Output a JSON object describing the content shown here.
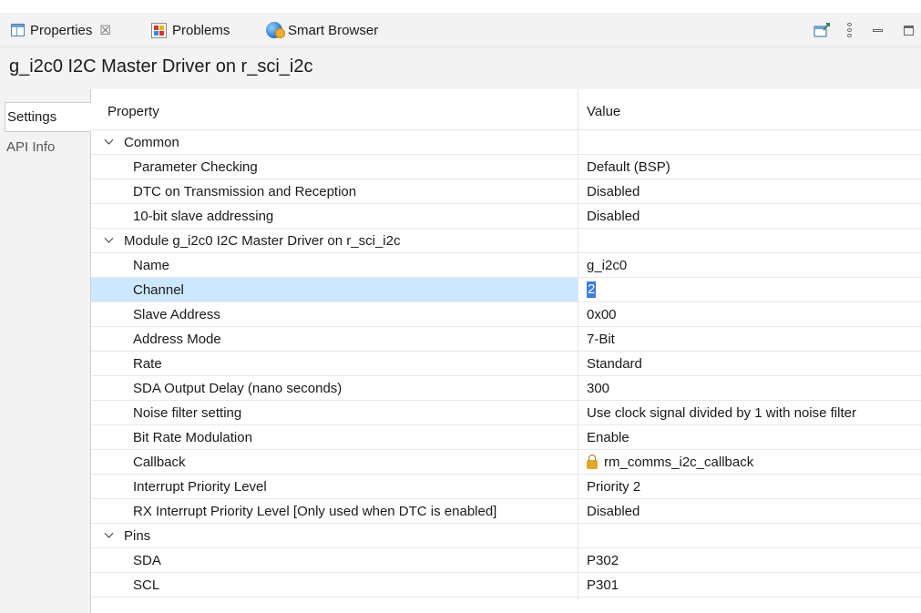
{
  "tabs": {
    "properties": "Properties",
    "properties_close": "☒",
    "problems": "Problems",
    "smart_browser": "Smart Browser"
  },
  "title": "g_i2c0 I2C Master Driver on r_sci_i2c",
  "side_tabs": [
    "Settings",
    "API Info"
  ],
  "table": {
    "header_property": "Property",
    "header_value": "Value"
  },
  "groups": {
    "common": {
      "label": "Common",
      "rows": [
        {
          "property": "Parameter Checking",
          "value": "Default (BSP)"
        },
        {
          "property": "DTC on Transmission and Reception",
          "value": "Disabled"
        },
        {
          "property": "10-bit slave addressing",
          "value": "Disabled"
        }
      ]
    },
    "module": {
      "label": "Module g_i2c0 I2C Master Driver on r_sci_i2c",
      "rows": [
        {
          "property": "Name",
          "value": "g_i2c0"
        },
        {
          "property": "Channel",
          "value": "2"
        },
        {
          "property": "Slave Address",
          "value": "0x00"
        },
        {
          "property": "Address Mode",
          "value": "7-Bit"
        },
        {
          "property": "Rate",
          "value": "Standard"
        },
        {
          "property": "SDA Output Delay (nano seconds)",
          "value": "300"
        },
        {
          "property": "Noise filter setting",
          "value": "Use clock signal divided by 1 with noise filter"
        },
        {
          "property": "Bit Rate Modulation",
          "value": "Enable"
        },
        {
          "property": "Callback",
          "value": "rm_comms_i2c_callback"
        },
        {
          "property": "Interrupt Priority Level",
          "value": "Priority 2"
        },
        {
          "property": "RX Interrupt Priority Level [Only used when DTC is enabled]",
          "value": "Disabled"
        }
      ]
    },
    "pins": {
      "label": "Pins",
      "rows": [
        {
          "property": "SDA",
          "value": "P302"
        },
        {
          "property": "SCL",
          "value": "P301"
        }
      ]
    }
  },
  "colors": {
    "selection": "#cce8ff",
    "edit_highlight": "#3b7be0",
    "tabbar_bg": "#f3f3f3"
  },
  "icons": [
    "properties-view-icon",
    "problems-view-icon",
    "smart-browser-icon",
    "pin-editor-icon",
    "view-menu-icon",
    "minimize-icon",
    "maximize-icon",
    "lock-icon",
    "chevron-down-icon"
  ]
}
